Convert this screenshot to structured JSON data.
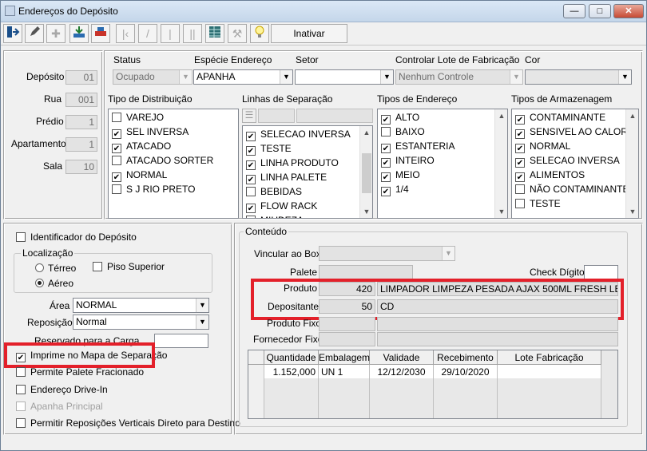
{
  "window": {
    "title": "Endereços do Depósito",
    "minimize": "—",
    "maximize": "□",
    "close": "✕"
  },
  "toolbar": {
    "inativar_label": "Inativar"
  },
  "header": {
    "deposito_label": "Depósito",
    "deposito_value": "01",
    "rua_label": "Rua",
    "rua_value": "001",
    "predio_label": "Prédio",
    "predio_value": "1",
    "apartamento_label": "Apartamento",
    "apartamento_value": "1",
    "sala_label": "Sala",
    "sala_value": "10",
    "status_label": "Status",
    "status_value": "Ocupado",
    "especie_label": "Espécie Endereço",
    "especie_value": "APANHA",
    "setor_label": "Setor",
    "setor_value": "",
    "lote_label": "Controlar Lote de Fabricação",
    "lote_value": "Nenhum Controle",
    "cor_label": "Cor",
    "cor_value": ""
  },
  "lists": {
    "tipo_distribuicao": {
      "title": "Tipo de Distribuição",
      "items": [
        {
          "label": "VAREJO",
          "checked": false
        },
        {
          "label": "SEL INVERSA",
          "checked": true
        },
        {
          "label": "ATACADO",
          "checked": true
        },
        {
          "label": "ATACADO SORTER",
          "checked": false
        },
        {
          "label": "NORMAL",
          "checked": true
        },
        {
          "label": "S J RIO PRETO",
          "checked": false
        }
      ]
    },
    "linhas_separacao": {
      "title": "Linhas de Separação",
      "items": [
        {
          "label": "SELECAO INVERSA",
          "checked": true
        },
        {
          "label": "TESTE",
          "checked": true
        },
        {
          "label": "LINHA PRODUTO",
          "checked": true
        },
        {
          "label": "LINHA PALETE",
          "checked": true
        },
        {
          "label": "BEBIDAS",
          "checked": false
        },
        {
          "label": "FLOW RACK",
          "checked": true
        },
        {
          "label": "MIUDEZA",
          "checked": false
        }
      ]
    },
    "tipos_endereco": {
      "title": "Tipos de Endereço",
      "items": [
        {
          "label": "ALTO",
          "checked": true
        },
        {
          "label": "BAIXO",
          "checked": false
        },
        {
          "label": "ESTANTERIA",
          "checked": true
        },
        {
          "label": "INTEIRO",
          "checked": true
        },
        {
          "label": "MEIO",
          "checked": true
        },
        {
          "label": "1/4",
          "checked": true
        }
      ]
    },
    "tipos_armazenagem": {
      "title": "Tipos de Armazenagem",
      "items": [
        {
          "label": "CONTAMINANTE",
          "checked": true
        },
        {
          "label": "SENSIVEL AO CALOR",
          "checked": true
        },
        {
          "label": "NORMAL",
          "checked": true
        },
        {
          "label": "SELECAO INVERSA",
          "checked": true
        },
        {
          "label": "ALIMENTOS",
          "checked": true
        },
        {
          "label": "NÃO CONTAMINANTE",
          "checked": false
        },
        {
          "label": "TESTE",
          "checked": false
        }
      ]
    }
  },
  "left": {
    "identificador_label": "Identificador do Depósito",
    "localizacao_label": "Localização",
    "terreo_label": "Térreo",
    "aereo_label": "Aéreo",
    "piso_superior_label": "Piso Superior",
    "area_label": "Área",
    "area_value": "NORMAL",
    "reposicao_label": "Reposição",
    "reposicao_value": "Normal",
    "reservado_label": "Reservado para a Carga",
    "reservado_value": "",
    "imprime_label": "Imprime no Mapa de Separação",
    "permite_palete_label": "Permite Palete Fracionado",
    "drive_in_label": "Endereço Drive-In",
    "apanha_principal_label": "Apanha Principal",
    "reposicoes_label": "Permitir Reposições Verticais Direto para Destino"
  },
  "conteudo": {
    "title": "Conteúdo",
    "vincular_label": "Vincular ao Box",
    "vincular_value": "",
    "palete_label": "Palete",
    "palete_value": "",
    "check_label": "Check Dígito",
    "check_value": "",
    "produto_label": "Produto",
    "produto_code": "420",
    "produto_desc": "LIMPADOR LIMPEZA PESADA AJAX 500ML FRESH LEMON",
    "depositante_label": "Depositante",
    "depositante_code": "50",
    "depositante_desc": "CD",
    "produto_fixo_label": "Produto Fixo",
    "fornecedor_fixo_label": "Fornecedor Fixo",
    "grid": {
      "headers": [
        "Quantidade",
        "Embalagem",
        "Validade",
        "Recebimento",
        "Lote Fabricação"
      ],
      "rows": [
        [
          "1.152,000",
          "UN 1",
          "12/12/2030",
          "29/10/2020",
          ""
        ]
      ]
    }
  }
}
